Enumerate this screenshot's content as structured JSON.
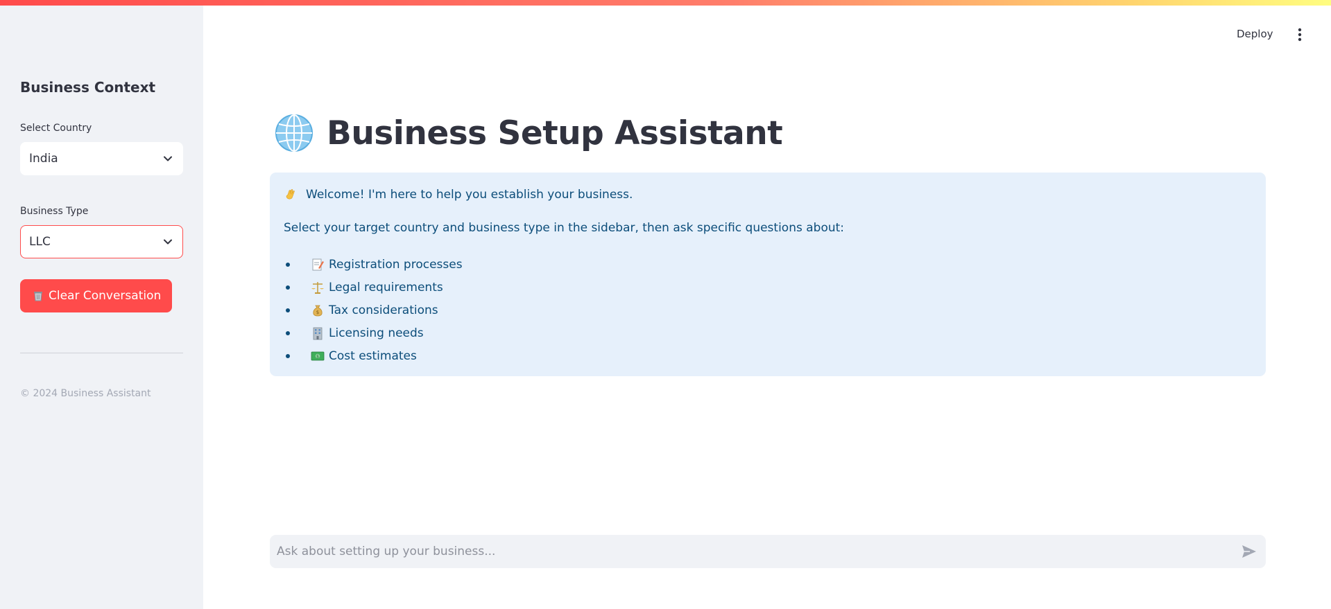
{
  "colors": {
    "accent": "#ff4b4b",
    "sidebar_bg": "#f0f2f6",
    "info_bg": "#e6f0fb",
    "info_text": "#0c4d7a"
  },
  "header": {
    "deploy_label": "Deploy",
    "menu_icon": "vertical-dots-icon"
  },
  "sidebar": {
    "title": "Business Context",
    "country": {
      "label": "Select Country",
      "value": "India"
    },
    "business_type": {
      "label": "Business Type",
      "value": "LLC"
    },
    "clear_button": {
      "icon": "trash-icon",
      "label": "Clear Conversation"
    },
    "footer": "© 2024 Business Assistant"
  },
  "main": {
    "title_icon": "globe-icon",
    "title": "Business Setup Assistant",
    "info": {
      "welcome_icon": "waving-hand-icon",
      "welcome": "Welcome! I'm here to help you establish your business.",
      "instruction": "Select your target country and business type in the sidebar, then ask specific questions about:",
      "items": [
        {
          "icon": "memo-icon",
          "label": "Registration processes"
        },
        {
          "icon": "scales-icon",
          "label": "Legal requirements"
        },
        {
          "icon": "money-bag-icon",
          "label": "Tax considerations"
        },
        {
          "icon": "office-building-icon",
          "label": "Licensing needs"
        },
        {
          "icon": "dollar-banknote-icon",
          "label": "Cost estimates"
        }
      ]
    },
    "chat": {
      "placeholder": "Ask about setting up your business...",
      "send_icon": "send-icon"
    }
  }
}
